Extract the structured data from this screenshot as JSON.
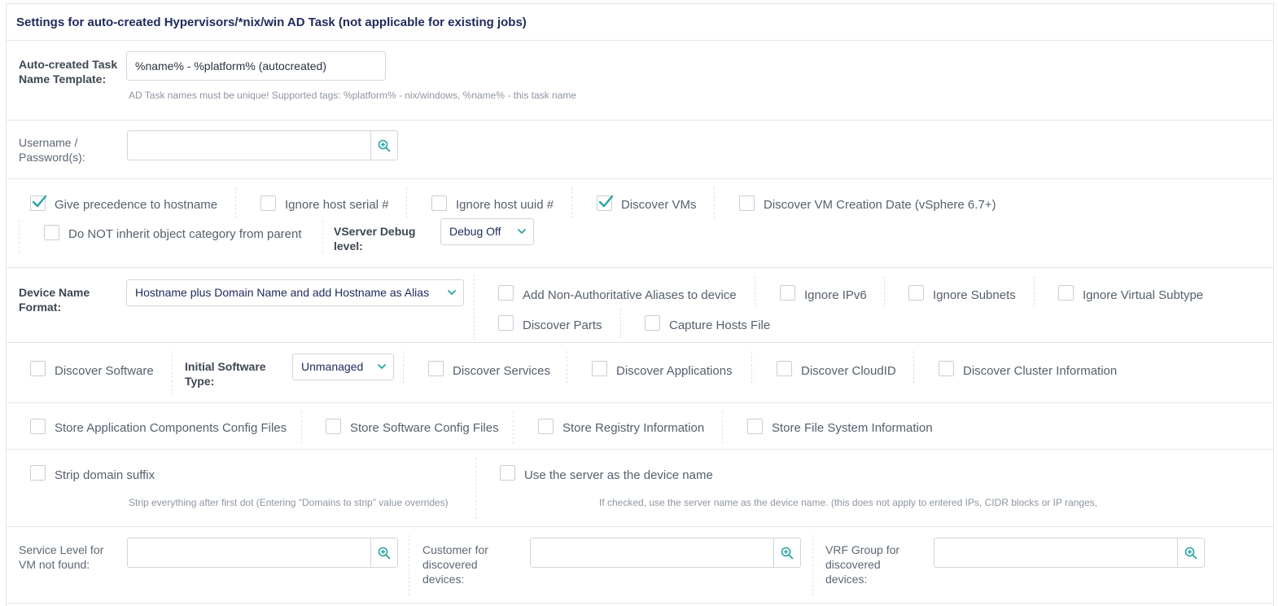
{
  "header": {
    "title": "Settings for auto-created Hypervisors/*nix/win AD Task (not applicable for existing jobs)"
  },
  "task_name": {
    "label_line1": "Auto-created Task",
    "label_line2": "Name Template:",
    "value": "%name% - %platform% (autocreated)",
    "help": "AD Task names must be unique! Supported tags: %platform% - nix/windows, %name% - this task name"
  },
  "credentials": {
    "label_line1": "Username /",
    "label_line2": "Password(s):",
    "value": ""
  },
  "discovery_row1": {
    "give_precedence": {
      "label": "Give precedence to hostname",
      "checked": true
    },
    "ignore_serial": {
      "label": "Ignore host serial #",
      "checked": false
    },
    "ignore_uuid": {
      "label": "Ignore host uuid #",
      "checked": false
    },
    "discover_vms": {
      "label": "Discover VMs",
      "checked": true
    },
    "discover_vm_creation": {
      "label": "Discover VM Creation Date (vSphere 6.7+)",
      "checked": false
    },
    "no_inherit_category": {
      "label": "Do NOT inherit object category from parent",
      "checked": false
    },
    "debug_label_line1": "VServer Debug",
    "debug_label_line2": "level:",
    "debug_value": "Debug Off"
  },
  "device_name": {
    "label_line1": "Device Name",
    "label_line2": "Format:",
    "value": "Hostname plus Domain Name and add Hostname as Alias",
    "add_aliases": {
      "label": "Add Non-Authoritative Aliases to device",
      "checked": false
    },
    "ignore_ipv6": {
      "label": "Ignore IPv6",
      "checked": false
    },
    "ignore_subnets": {
      "label": "Ignore Subnets",
      "checked": false
    },
    "ignore_virtual_subtype": {
      "label": "Ignore Virtual Subtype",
      "checked": false
    },
    "discover_parts": {
      "label": "Discover Parts",
      "checked": false
    },
    "capture_hosts": {
      "label": "Capture Hosts File",
      "checked": false
    }
  },
  "software": {
    "discover_software": {
      "label": "Discover Software",
      "checked": false
    },
    "initial_type_label_line1": "Initial Software",
    "initial_type_label_line2": "Type:",
    "initial_type_value": "Unmanaged",
    "discover_services": {
      "label": "Discover Services",
      "checked": false
    },
    "discover_applications": {
      "label": "Discover Applications",
      "checked": false
    },
    "discover_cloudid": {
      "label": "Discover CloudID",
      "checked": false
    },
    "discover_cluster": {
      "label": "Discover Cluster Information",
      "checked": false
    }
  },
  "store": {
    "app_components": {
      "label": "Store Application Components Config Files",
      "checked": false
    },
    "software_config": {
      "label": "Store Software Config Files",
      "checked": false
    },
    "registry": {
      "label": "Store Registry Information",
      "checked": false
    },
    "file_system": {
      "label": "Store File System Information",
      "checked": false
    }
  },
  "naming": {
    "strip_domain": {
      "label": "Strip domain suffix",
      "checked": false,
      "help": "Strip everything after first dot (Entering \"Domains to strip\" value overrides)"
    },
    "use_server": {
      "label": "Use the server as the device name",
      "checked": false,
      "help": "If checked, use the server name as the device name. (this does not apply to entered IPs, CIDR blocks or IP ranges,"
    }
  },
  "assignments": {
    "service_level": {
      "label_line1": "Service Level for",
      "label_line2": "VM not found:",
      "value": ""
    },
    "customer": {
      "label_line1": "Customer for",
      "label_line2": "discovered",
      "label_line3": "devices:",
      "value": ""
    },
    "vrf_group": {
      "label_line1": "VRF Group for",
      "label_line2": "discovered",
      "label_line3": "devices:",
      "value": ""
    }
  },
  "colors": {
    "accent": "#2aa4a4",
    "header_text": "#1d2a5c",
    "border": "#e1e4e8"
  }
}
